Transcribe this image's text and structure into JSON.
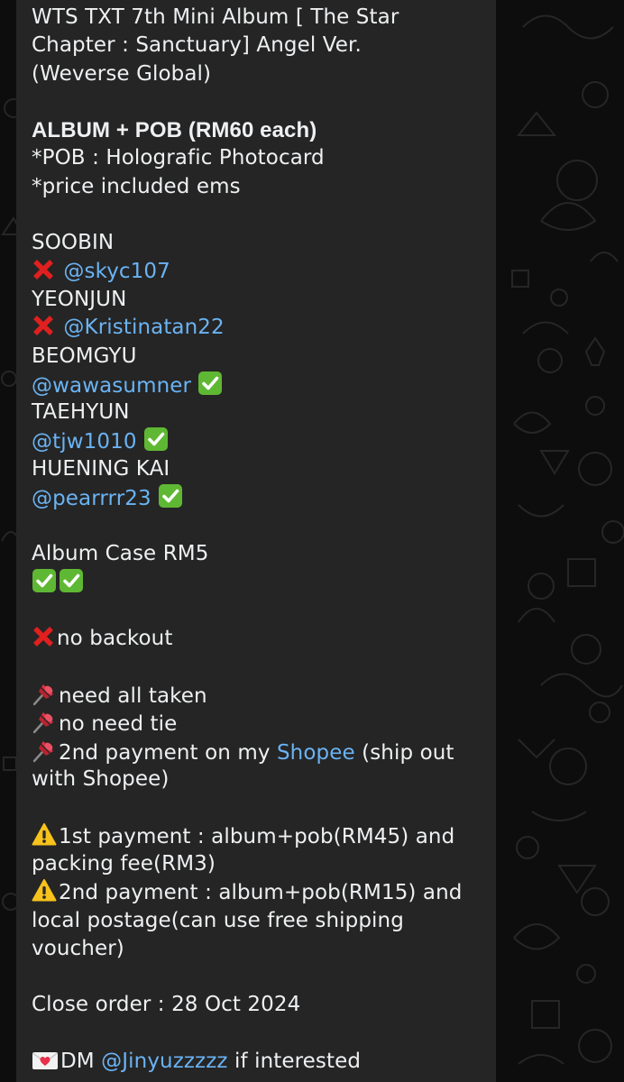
{
  "message": {
    "title": [
      "WTS TXT 7th Mini Album [ The Star",
      "Chapter : Sanctuary] Angel Ver.",
      "(Weverse Global)"
    ],
    "album_heading": "ALBUM + POB (RM60 each)",
    "pob_note": "*POB : Holografic Photocard",
    "price_note": "*price included ems",
    "members": [
      {
        "name": "SOOBIN",
        "status_icon": "cross-mark-icon",
        "handle": "@skyc107"
      },
      {
        "name": "YEONJUN",
        "status_icon": "cross-mark-icon",
        "handle": "@Kristinatan22"
      },
      {
        "name": "BEOMGYU",
        "status_icon": "check-mark-icon",
        "handle": "@wawasumner"
      },
      {
        "name": "TAEHYUN",
        "status_icon": "check-mark-icon",
        "handle": "@tjw1010"
      },
      {
        "name": "HUENING KAI",
        "status_icon": "check-mark-icon",
        "handle": "@pearrrr23"
      }
    ],
    "album_case": "Album Case RM5",
    "no_backout": "no backout",
    "pins": {
      "need_all_taken": "need all taken",
      "no_need_tie": "no need tie",
      "second_payment_prefix": "2nd payment on my ",
      "shopee_link": "Shopee",
      "second_payment_suffix": " (ship out",
      "second_payment_cont": "with Shopee)"
    },
    "payments": {
      "first_line1": "1st payment : album+pob(RM45) and",
      "first_line2": "packing fee(RM3)",
      "second_line1": "2nd payment : album+pob(RM15) and",
      "second_line2": "local postage(can use free shipping",
      "second_line3": "voucher)"
    },
    "close_order": "Close order : 28 Oct 2024",
    "dm": {
      "prefix": "DM ",
      "handle": "@Jinyuzzzzz",
      "suffix": " if interested"
    }
  },
  "colors": {
    "background": "#0d0d0d",
    "bubble": "#252525",
    "text": "#eef0f2",
    "link": "#6ab3f3",
    "cross": "#e0201e",
    "check": "#5fb833",
    "pin": "#dd2e44",
    "warning": "#f7c21b"
  }
}
